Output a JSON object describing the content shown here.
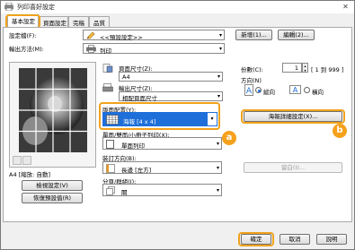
{
  "window": {
    "title": "列印喜好設定"
  },
  "tabs": [
    {
      "label": "基本設定"
    },
    {
      "label": "頁面設定"
    },
    {
      "label": "完稿"
    },
    {
      "label": "品質"
    }
  ],
  "profile": {
    "label": "設定檔(F):",
    "value": "<<預設設定>>",
    "add_label": "新增(1)...",
    "edit_label": "編輯(2)..."
  },
  "output_method": {
    "label": "輸出方法(M):",
    "value": "列印"
  },
  "page_size": {
    "label": "頁面尺寸(Z):",
    "value": "A4"
  },
  "output_size": {
    "label": "輸出尺寸(Z):",
    "value": "相配頁面尺寸"
  },
  "copies": {
    "label": "份數(C):",
    "value": "1",
    "range": "[ 1 到 999 ]"
  },
  "orientation": {
    "label": "方向(N)",
    "portrait": "縱向",
    "landscape": "橫向"
  },
  "page_layout": {
    "label": "版面配置(Y):",
    "value": "海報 [4 x 4]",
    "details_label": "海報詳細設定(X)..."
  },
  "duplex": {
    "label": "單面/雙面/小冊子列印(X):",
    "value": "單面列印"
  },
  "binding": {
    "label": "裝訂方向(B):",
    "value": "長邊 [左方]",
    "margin_label": "留白(I)..."
  },
  "stapling": {
    "label": "分頁/群組(I):",
    "value": "關"
  },
  "preview": {
    "caption": "A4 [縮放: 自動]",
    "view_settings": "檢視設定(V)",
    "restore_defaults": "恢復預設值(R)"
  },
  "badges": {
    "a": "a",
    "b": "b"
  },
  "footer": {
    "ok": "確定",
    "cancel": "取消",
    "help": "說明"
  },
  "colors": {
    "accent": "#f0a21b",
    "selected": "#1e6fd9"
  }
}
